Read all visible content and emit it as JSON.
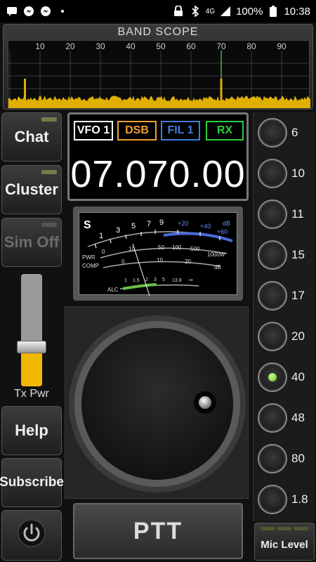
{
  "status_bar": {
    "network": "4G",
    "battery": "100%",
    "time": "10:38",
    "icons_left": [
      "message-icon",
      "messenger-icon",
      "messenger-icon",
      "dot"
    ],
    "icons_right": [
      "lock-icon",
      "bluetooth-icon",
      "signal-icon",
      "battery-icon"
    ]
  },
  "band_scope": {
    "title": "BAND SCOPE",
    "ticks": [
      "10",
      "20",
      "30",
      "40",
      "50",
      "60",
      "70",
      "80",
      "90"
    ],
    "marker_at": 70,
    "spikes": [
      5,
      70
    ],
    "colors": {
      "fill": "#e0b000",
      "marker": "#4caf50"
    }
  },
  "left_buttons": [
    {
      "label": "Chat",
      "enabled": true
    },
    {
      "label": "Cluster",
      "enabled": true
    },
    {
      "label": "Sim Off",
      "enabled": false
    }
  ],
  "tx_power": {
    "label": "Tx Pwr",
    "level": 0.35
  },
  "left_buttons_lower": [
    {
      "label": "Help"
    },
    {
      "label": "Subscribe"
    }
  ],
  "power_button": {
    "icon": "power-icon"
  },
  "display": {
    "vfo": "VFO 1",
    "mode": "DSB",
    "filter": "FIL 1",
    "rxtx": "RX",
    "frequency": "07.070.00",
    "colors": {
      "vfo": "#ffffff",
      "mode": "#f0a030",
      "filter": "#3f7fe0",
      "rxtx": "#2ecc40"
    }
  },
  "meter": {
    "s_label": "S",
    "s_ticks": [
      "1",
      "3",
      "5",
      "7",
      "9"
    ],
    "plus_ticks": [
      "+20",
      "+40",
      "+60"
    ],
    "db_label": "dB",
    "pwr_label": "PWR",
    "pwr_ticks": [
      "0",
      "10",
      "50",
      "100",
      "500",
      "1000W"
    ],
    "comp_label": "COMP",
    "comp_ticks": [
      "0",
      "10",
      "20",
      "dB"
    ],
    "alc_label": "ALC",
    "swr_ticks": [
      "1",
      "1.5",
      "2",
      "3",
      "5",
      "13.8",
      "∞"
    ]
  },
  "ptt": {
    "label": "PTT"
  },
  "bands": [
    {
      "label": "6",
      "selected": false
    },
    {
      "label": "10",
      "selected": false
    },
    {
      "label": "11",
      "selected": false
    },
    {
      "label": "15",
      "selected": false
    },
    {
      "label": "17",
      "selected": false
    },
    {
      "label": "20",
      "selected": false
    },
    {
      "label": "40",
      "selected": true
    },
    {
      "label": "48",
      "selected": false
    },
    {
      "label": "80",
      "selected": false
    },
    {
      "label": "1.8",
      "selected": false
    }
  ],
  "mic_level": {
    "label": "Mic Level"
  }
}
